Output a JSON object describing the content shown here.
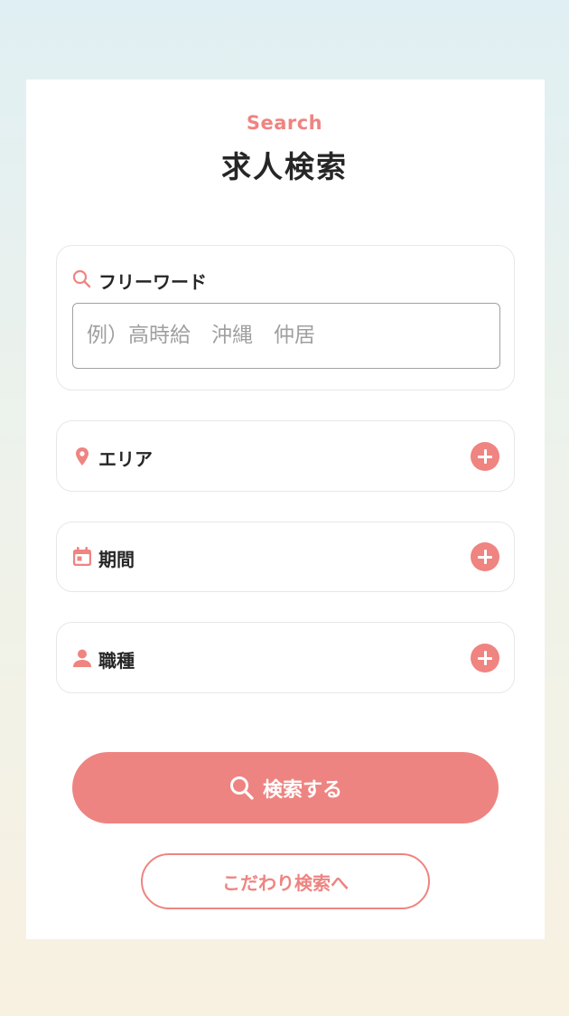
{
  "colors": {
    "accent": "#ee8481",
    "text": "#262626",
    "placeholder": "#9f9f9f",
    "card_border": "#e7e7e7"
  },
  "header": {
    "eyebrow": "Search",
    "title": "求人検索"
  },
  "freeword": {
    "label": "フリーワード",
    "icon": "search-icon",
    "placeholder": "例）高時給　沖縄　仲居",
    "value": ""
  },
  "filters": [
    {
      "label": "エリア",
      "icon": "location-pin-icon",
      "action_icon": "plus-circle-icon"
    },
    {
      "label": "期間",
      "icon": "calendar-icon",
      "action_icon": "plus-circle-icon"
    },
    {
      "label": "職種",
      "icon": "person-icon",
      "action_icon": "plus-circle-icon"
    }
  ],
  "buttons": {
    "search_label": "検索する",
    "search_icon": "search-icon",
    "detail_label": "こだわり検索へ"
  }
}
